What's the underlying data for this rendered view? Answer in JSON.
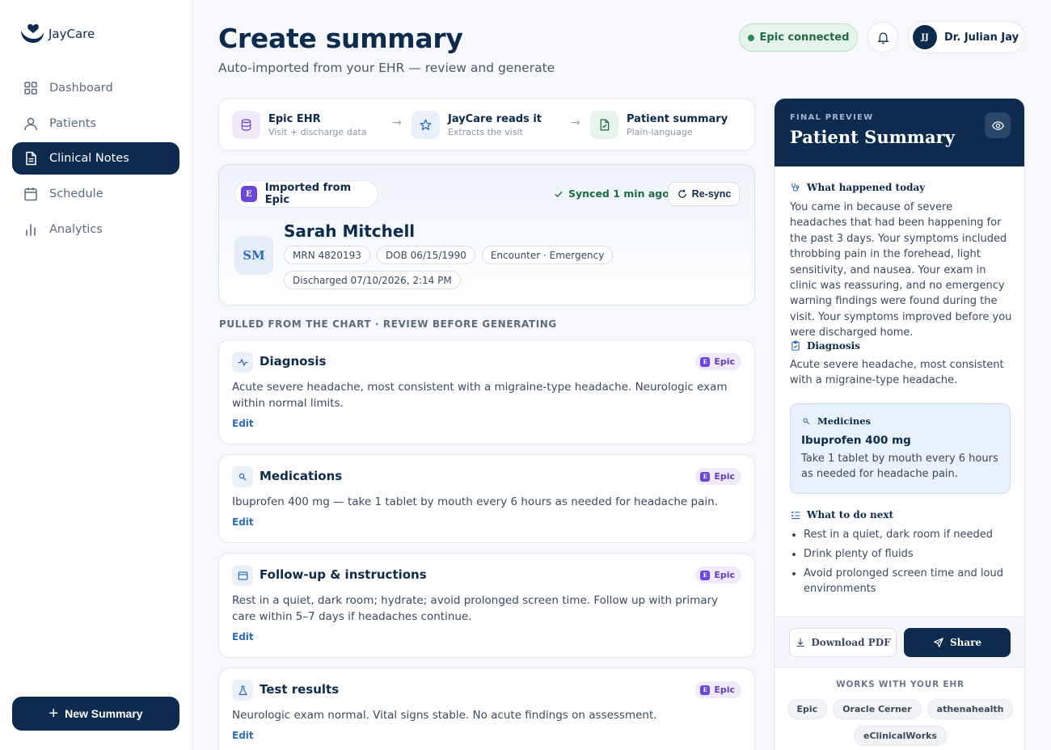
{
  "app": {
    "brand": "JayCare"
  },
  "sidebar": {
    "items": [
      {
        "label": "Dashboard",
        "icon": "grid-icon",
        "active": false
      },
      {
        "label": "Patients",
        "icon": "user-icon",
        "active": false
      },
      {
        "label": "Clinical Notes",
        "icon": "document-icon",
        "active": true
      },
      {
        "label": "Schedule",
        "icon": "calendar-icon",
        "active": false
      },
      {
        "label": "Analytics",
        "icon": "bar-chart-icon",
        "active": false
      }
    ],
    "new_summary_label": "New Summary"
  },
  "header": {
    "title": "Create summary",
    "subtitle": "Auto-imported from your EHR — review and generate",
    "status_label": "Epic connected",
    "user_initials": "JJ",
    "user_name": "Dr. Julian Jay"
  },
  "flow": [
    {
      "title": "Epic EHR",
      "subtitle": "Visit + discharge data",
      "icon": "database-icon"
    },
    {
      "title": "JayCare reads it",
      "subtitle": "Extracts the visit",
      "icon": "sparkle-icon"
    },
    {
      "title": "Patient summary",
      "subtitle": "Plain-language",
      "icon": "file-check-icon"
    }
  ],
  "patient": {
    "import_label": "Imported from Epic",
    "import_badge": "E",
    "sync_status": "Synced 1 min ago",
    "resync_label": "Re-sync",
    "initials": "SM",
    "name": "Sarah Mitchell",
    "tags": [
      "MRN 4820193",
      "DOB 06/15/1990",
      "Encounter · Emergency",
      "Discharged 07/10/2026, 2:14 PM"
    ]
  },
  "section_label": "PULLED FROM THE CHART · REVIEW BEFORE GENERATING",
  "cards": [
    {
      "title": "Diagnosis",
      "badge": "Epic",
      "icon": "pulse-icon",
      "body": "Acute severe headache, most consistent with a migraine-type headache. Neurologic exam within normal limits.",
      "edit": "Edit"
    },
    {
      "title": "Medications",
      "badge": "Epic",
      "icon": "pill-icon",
      "body": "Ibuprofen 400 mg — take 1 tablet by mouth every 6 hours as needed for headache pain.",
      "edit": "Edit"
    },
    {
      "title": "Follow-up & instructions",
      "badge": "Epic",
      "icon": "window-icon",
      "body": "Rest in a quiet, dark room; hydrate; avoid prolonged screen time. Follow up with primary care within 5–7 days if headaches continue.",
      "edit": "Edit"
    },
    {
      "title": "Test results",
      "badge": "Epic",
      "icon": "flask-icon",
      "body": "Neurologic exam normal. Vital signs stable. No acute findings on assessment.",
      "edit": "Edit"
    }
  ],
  "preview": {
    "kicker": "FINAL PREVIEW",
    "title": "Patient Summary",
    "what_happened_heading": "What happened today",
    "what_happened_text": "You came in because of severe headaches that had been happening for the past 3 days. Your symptoms included throbbing pain in the forehead, light sensitivity, and nausea. Your exam in clinic was reassuring, and no emergency warning findings were found during the visit. Your symptoms improved before you were discharged home.",
    "diagnosis_heading": "Diagnosis",
    "diagnosis_text": "Acute severe headache, most consistent with a migraine-type headache.",
    "medicines_heading": "Medicines",
    "medicine_name": "Ibuprofen 400 mg",
    "medicine_text": "Take 1 tablet by mouth every 6 hours as needed for headache pain.",
    "next_heading": "What to do next",
    "next_items": [
      "Rest in a quiet, dark room if needed",
      "Drink plenty of fluids",
      "Avoid prolonged screen time and loud environments"
    ],
    "download_label": "Download PDF",
    "share_label": "Share",
    "works_label": "WORKS WITH YOUR EHR",
    "ehr_list": [
      "Epic",
      "Oracle Cerner",
      "athenahealth",
      "eClinicalWorks"
    ]
  },
  "colors": {
    "navy": "#0d2b4e",
    "accent_blue": "#2e6cb8",
    "epic_purple": "#6b46d9",
    "success_green": "#1f6b40"
  }
}
